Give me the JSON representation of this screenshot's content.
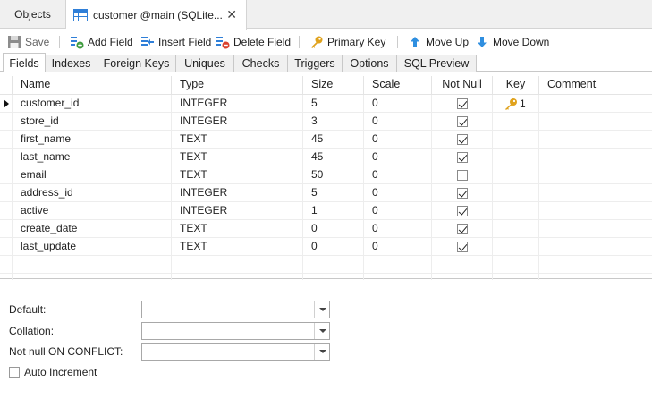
{
  "doc_tabs": {
    "objects_label": "Objects",
    "active_label": "customer @main (SQLite..."
  },
  "toolbar": {
    "save": "Save",
    "add_field": "Add Field",
    "insert_field": "Insert Field",
    "delete_field": "Delete Field",
    "primary_key": "Primary Key",
    "move_up": "Move Up",
    "move_down": "Move Down"
  },
  "sub_tabs": [
    "Fields",
    "Indexes",
    "Foreign Keys",
    "Uniques",
    "Checks",
    "Triggers",
    "Options",
    "SQL Preview"
  ],
  "grid": {
    "columns": [
      "Name",
      "Type",
      "Size",
      "Scale",
      "Not Null",
      "Key",
      "Comment"
    ],
    "rows": [
      {
        "name": "customer_id",
        "type": "INTEGER",
        "size": "5",
        "scale": "0",
        "not_null": true,
        "key": "1",
        "comment": ""
      },
      {
        "name": "store_id",
        "type": "INTEGER",
        "size": "3",
        "scale": "0",
        "not_null": true,
        "key": "",
        "comment": ""
      },
      {
        "name": "first_name",
        "type": "TEXT",
        "size": "45",
        "scale": "0",
        "not_null": true,
        "key": "",
        "comment": ""
      },
      {
        "name": "last_name",
        "type": "TEXT",
        "size": "45",
        "scale": "0",
        "not_null": true,
        "key": "",
        "comment": ""
      },
      {
        "name": "email",
        "type": "TEXT",
        "size": "50",
        "scale": "0",
        "not_null": false,
        "key": "",
        "comment": ""
      },
      {
        "name": "address_id",
        "type": "INTEGER",
        "size": "5",
        "scale": "0",
        "not_null": true,
        "key": "",
        "comment": ""
      },
      {
        "name": "active",
        "type": "INTEGER",
        "size": "1",
        "scale": "0",
        "not_null": true,
        "key": "",
        "comment": ""
      },
      {
        "name": "create_date",
        "type": "TEXT",
        "size": "0",
        "scale": "0",
        "not_null": true,
        "key": "",
        "comment": ""
      },
      {
        "name": "last_update",
        "type": "TEXT",
        "size": "0",
        "scale": "0",
        "not_null": true,
        "key": "",
        "comment": ""
      }
    ]
  },
  "form": {
    "default_label": "Default:",
    "default_value": "",
    "collation_label": "Collation:",
    "collation_value": "",
    "conflict_label": "Not null ON CONFLICT:",
    "conflict_value": "",
    "auto_increment_label": "Auto Increment",
    "auto_increment_checked": false
  },
  "icons": {
    "table": "table-icon",
    "save": "save-icon",
    "add_field": "add-field-icon",
    "insert_field": "insert-field-icon",
    "delete_field": "delete-field-icon",
    "primary_key": "key-icon",
    "move_up": "arrow-up-icon",
    "move_down": "arrow-down-icon"
  },
  "colors": {
    "accent_blue": "#2f7fd8",
    "add_green": "#3c9a3c",
    "delete_red": "#d9412e",
    "key_gold": "#e0a21c"
  }
}
